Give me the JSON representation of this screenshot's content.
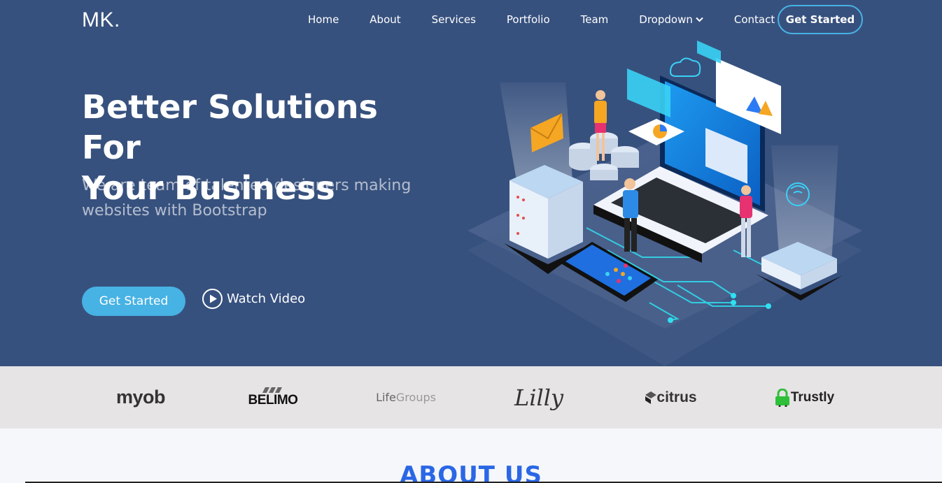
{
  "brand": {
    "logo": "MK."
  },
  "nav": {
    "items": [
      {
        "label": "Home"
      },
      {
        "label": "About"
      },
      {
        "label": "Services"
      },
      {
        "label": "Portfolio"
      },
      {
        "label": "Team"
      },
      {
        "label": "Dropdown"
      },
      {
        "label": "Contact"
      }
    ],
    "cta": "Get Started"
  },
  "hero": {
    "title_line1": "Better Solutions For",
    "title_line2": "Your Business",
    "subtitle": "We are team of talented designers making websites with Bootstrap",
    "primary_button": "Get Started",
    "video_button": "Watch Video"
  },
  "clients": {
    "myob": "myob",
    "belimo": "BELIMO",
    "lifegroups_a": "Life",
    "lifegroups_b": "Groups",
    "lilly": "Lilly",
    "citrus": "citrus",
    "trustly": "Trustly"
  },
  "about": {
    "title": "ABOUT US"
  },
  "colors": {
    "hero_bg": "#37517e",
    "accent": "#47b2e4",
    "clients_bg": "#e6e4e5",
    "section_title": "#2a67e6"
  },
  "icons": [
    "chevron-down-icon",
    "play-icon",
    "hero-illustration"
  ]
}
